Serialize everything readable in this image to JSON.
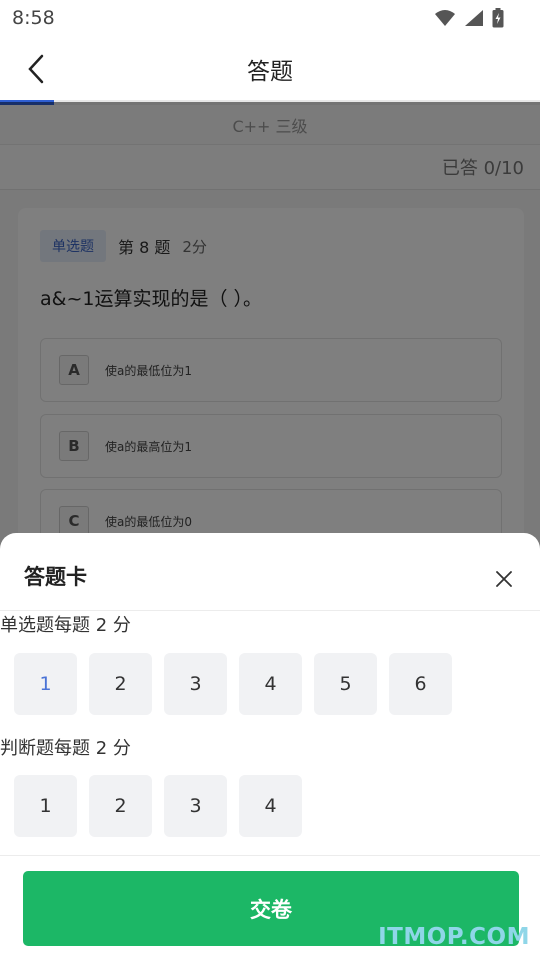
{
  "status_bar": {
    "time": "8:58"
  },
  "header": {
    "title": "答题",
    "progress_fraction": 0.1
  },
  "subject": {
    "name": "C++ 三级"
  },
  "answered": {
    "text": "已答 0/10"
  },
  "question": {
    "type_badge": "单选题",
    "number": "第 8 题",
    "score": "2分",
    "text": "a&~1运算实现的是（ ）。",
    "options": [
      {
        "letter": "A",
        "text": "使a的最低位为1"
      },
      {
        "letter": "B",
        "text": "使a的最高位为1"
      },
      {
        "letter": "C",
        "text": "使a的最低位为0"
      }
    ]
  },
  "answer_card": {
    "title": "答题卡",
    "sections": [
      {
        "label": "单选题每题 2 分",
        "numbers": [
          "1",
          "2",
          "3",
          "4",
          "5",
          "6"
        ],
        "current": "1"
      },
      {
        "label": "判断题每题 2 分",
        "numbers": [
          "1",
          "2",
          "3",
          "4"
        ],
        "current": ""
      }
    ],
    "submit_label": "交卷"
  },
  "watermark": "ITMOP.COM",
  "colors": {
    "accent_blue": "#2f5fd3",
    "submit_green": "#1cb766",
    "badge_bg": "#e7eefb",
    "cell_bg": "#f1f2f4"
  }
}
